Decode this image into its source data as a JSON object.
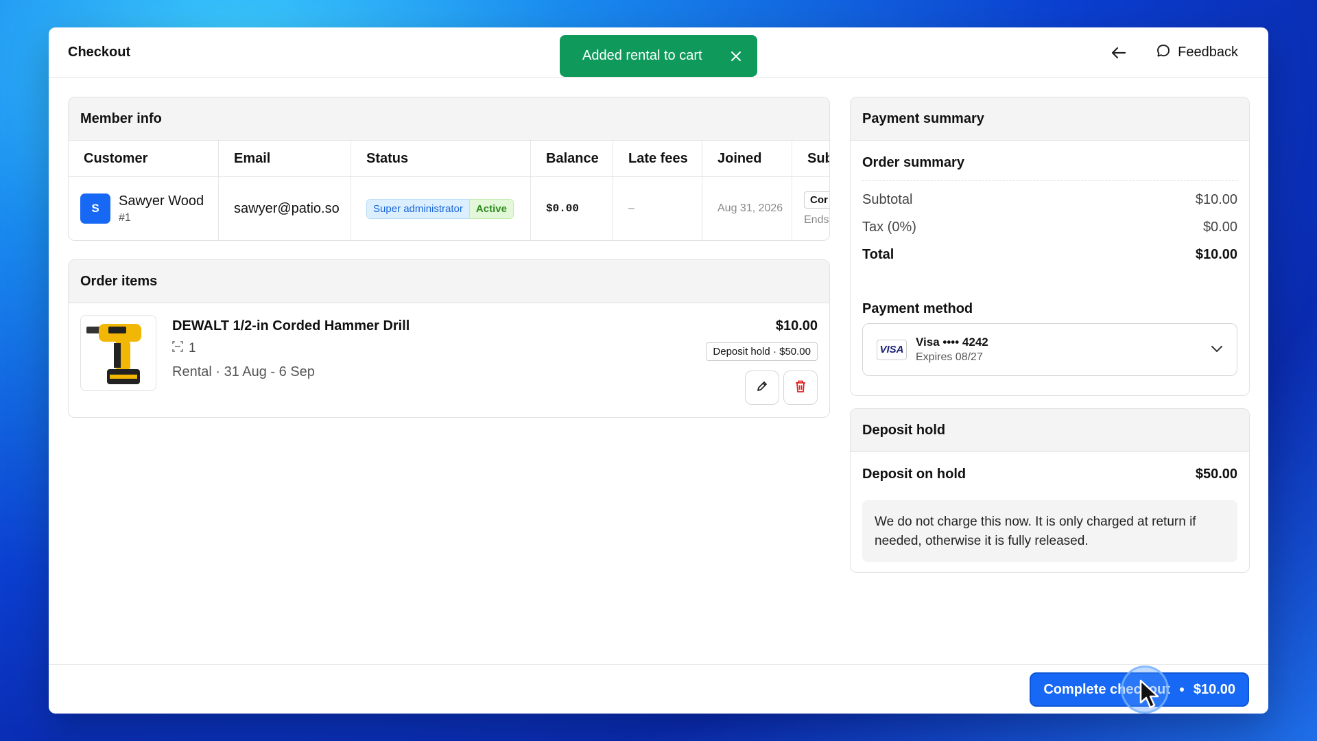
{
  "header": {
    "title": "Checkout",
    "feedback_label": "Feedback"
  },
  "toast": {
    "message": "Added rental to cart"
  },
  "member_info": {
    "title": "Member info",
    "columns": [
      "Customer",
      "Email",
      "Status",
      "Balance",
      "Late fees",
      "Joined",
      "Sub"
    ],
    "row": {
      "avatar_initial": "S",
      "name": "Sawyer Wood",
      "id": "#1",
      "email": "sawyer@patio.so",
      "role_badge": "Super administrator",
      "status_badge": "Active",
      "balance": "$0.00",
      "late_fees": "–",
      "joined": "Aug 31, 2026",
      "sub_pill": "Cor",
      "sub_ends": "Ends"
    }
  },
  "order_items": {
    "title": "Order items",
    "item": {
      "name": "DEWALT 1/2-in Corded Hammer Drill",
      "qty": "1",
      "rental": "Rental · 31 Aug - 6 Sep",
      "price": "$10.00",
      "deposit": "Deposit hold · $50.00"
    }
  },
  "payment_summary": {
    "title": "Payment summary",
    "order_summary_label": "Order summary",
    "subtotal_label": "Subtotal",
    "subtotal": "$10.00",
    "tax_label": "Tax (0%)",
    "tax": "$0.00",
    "total_label": "Total",
    "total": "$10.00",
    "method_label": "Payment method",
    "card_brand": "VISA",
    "card_line": "Visa •••• 4242",
    "card_expiry": "Expires 08/27"
  },
  "deposit_hold": {
    "title": "Deposit hold",
    "label": "Deposit on hold",
    "amount": "$50.00",
    "note": "We do not charge this now. It is only charged at return if needed, otherwise it is fully released."
  },
  "footer": {
    "checkout_label": "Complete checkout",
    "checkout_amount": "$10.00"
  },
  "colors": {
    "primary": "#1668f5",
    "toast": "#0f9a5c",
    "danger": "#e02424"
  }
}
